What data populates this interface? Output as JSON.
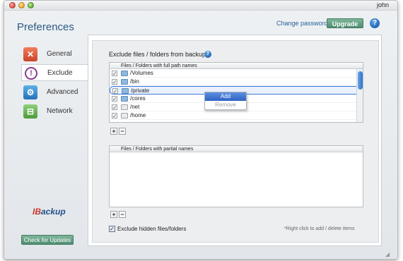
{
  "titlebar": {
    "username": "john"
  },
  "header": {
    "title": "Preferences",
    "change_password": "Change password",
    "upgrade": "Upgrade",
    "help": "?"
  },
  "sidebar": {
    "items": [
      {
        "label": "General",
        "icon": "wrench-icon"
      },
      {
        "label": "Exclude",
        "icon": "exclude-icon"
      },
      {
        "label": "Advanced",
        "icon": "gear-icon"
      },
      {
        "label": "Network",
        "icon": "network-icon"
      }
    ],
    "selected": "Exclude",
    "logo_ib": "IB",
    "logo_backup": "ackup",
    "check_updates": "Check for Updates"
  },
  "exclude": {
    "title": "Exclude files / folders from backup",
    "full_path_header": "Files / Folders with full path names",
    "full_path_items": [
      {
        "name": "/Volumes",
        "checked": true
      },
      {
        "name": "/bin",
        "checked": true
      },
      {
        "name": "/private",
        "checked": true,
        "selected": true
      },
      {
        "name": "/cores",
        "checked": true
      },
      {
        "name": "/net",
        "checked": true
      },
      {
        "name": "/home",
        "checked": true
      }
    ],
    "partial_header": "Files / Folders with partial names",
    "context_menu": {
      "add": "Add",
      "remove": "Remove"
    },
    "add_symbol": "+",
    "remove_symbol": "−",
    "hidden_checkbox_label": "Exclude hidden files/folders",
    "hidden_checked": true,
    "hint": "*Right click to add / delete items"
  },
  "colors": {
    "accent_green": "#4f8d71",
    "title_blue": "#2c5a86",
    "selection_blue": "#3b78d6"
  }
}
